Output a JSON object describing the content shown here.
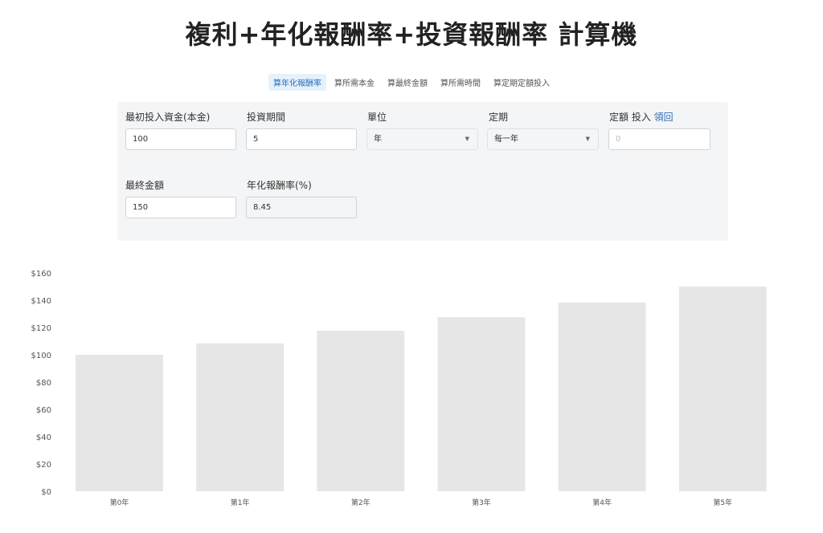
{
  "title": "複利+年化報酬率+投資報酬率 計算機",
  "tabs": [
    {
      "label": "算年化報酬率",
      "active": true
    },
    {
      "label": "算所需本金",
      "active": false
    },
    {
      "label": "算最終金額",
      "active": false
    },
    {
      "label": "算所需時間",
      "active": false
    },
    {
      "label": "算定期定額投入",
      "active": false
    }
  ],
  "form": {
    "principal": {
      "label": "最初投入資金(本金)",
      "value": "100"
    },
    "period": {
      "label": "投資期間",
      "value": "5"
    },
    "unit": {
      "label": "單位",
      "value": "年"
    },
    "frequency": {
      "label": "定期",
      "value": "每一年"
    },
    "regular": {
      "label": "定額 投入",
      "link": "領回",
      "placeholder": "0"
    },
    "final_amount": {
      "label": "最終金額",
      "value": "150"
    },
    "annual_rate": {
      "label": "年化報酬率(%)",
      "value": "8.45"
    }
  },
  "colors": {
    "accent": "#2c6fb7",
    "bar": "#e6e6e6",
    "panel": "#f4f5f7"
  },
  "chart_data": {
    "type": "bar",
    "categories": [
      "第0年",
      "第1年",
      "第2年",
      "第3年",
      "第4年",
      "第5年"
    ],
    "values": [
      100,
      108.45,
      117.61,
      127.55,
      138.33,
      150
    ],
    "ylim": [
      0,
      160
    ],
    "yticks": [
      "$0",
      "$20",
      "$40",
      "$60",
      "$80",
      "$100",
      "$120",
      "$140",
      "$160"
    ],
    "grid": false
  }
}
